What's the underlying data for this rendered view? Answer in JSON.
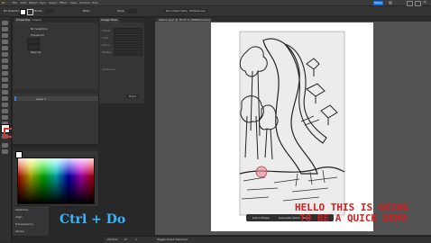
{
  "menubar": {
    "items": [
      "Ai",
      "File",
      "Edit",
      "Object",
      "Type",
      "Select",
      "Effect",
      "View",
      "Window",
      "Help"
    ],
    "share_label": "Share"
  },
  "control_bar": {
    "selection_label": "No Selection",
    "stroke_label": "Stroke",
    "basic_label": "Basic",
    "style_label": "Style",
    "document_setup_label": "Document Setup",
    "preferences_label": "Preferences"
  },
  "document_tab": {
    "title": "Sketch.jpg* @ 18.22 % (RGB/Preview)"
  },
  "properties_panel": {
    "tabs": [
      "Properties",
      "Layers"
    ],
    "no_selection": "No Selection",
    "transform_label": "Transform",
    "opacity_label": "Opacity",
    "layer_name": "Layer 1"
  },
  "image_trace_panel": {
    "title": "Image Trace",
    "preset_label": "Preset",
    "view_label": "View",
    "mode_label": "Mode",
    "palette_label": "Palette",
    "advanced_label": "Advanced",
    "trace_button": "Trace"
  },
  "color_panel": {
    "accent": "#38b6ff"
  },
  "bottom_panels": {
    "items": [
      "Swatches",
      "Align",
      "Transparency",
      "Stroke"
    ]
  },
  "overlay": {
    "shortcut_text": "Ctrl + Do",
    "caption_line1": "HELLO THIS IS GOING",
    "caption_line2": "TO BE A QUICK DEMO",
    "caption_color": "#d11f1f"
  },
  "context_bar": {
    "add_shape_label": "Add a Shape",
    "generate_label": "Generate Vector (Beta)"
  },
  "status_bar": {
    "zoom": "18.22%",
    "angle": "0°",
    "artboard": "1",
    "tool": "Toggle Direct Selection"
  }
}
